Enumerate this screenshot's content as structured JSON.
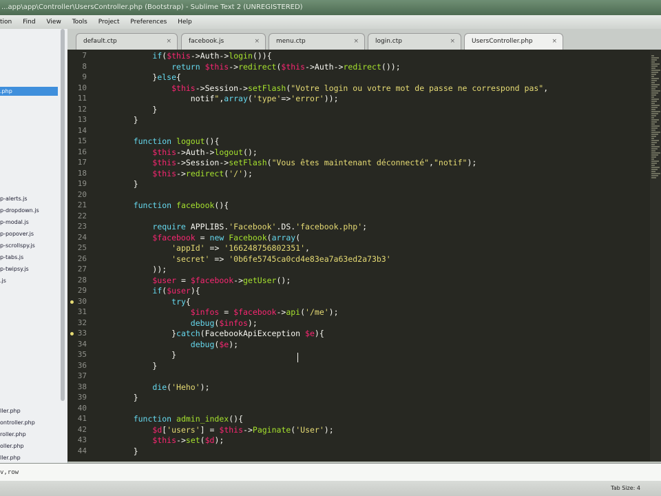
{
  "window": {
    "title": "...app\\app\\Controller\\UsersController.php (Bootstrap) - Sublime Text 2 (UNREGISTERED)"
  },
  "menu": [
    "tion",
    "Find",
    "View",
    "Tools",
    "Project",
    "Preferences",
    "Help"
  ],
  "sidebar": {
    "items": [
      {
        "label": ".php",
        "selected": true
      },
      {
        "label": "p-alerts.js"
      },
      {
        "label": "p-dropdown.js"
      },
      {
        "label": "p-modal.js"
      },
      {
        "label": "p-popover.js"
      },
      {
        "label": "p-scrollspy.js"
      },
      {
        "label": "p-tabs.js"
      },
      {
        "label": "p-twipsy.js"
      },
      {
        "label": ".js"
      },
      {
        "label": "ller.php"
      },
      {
        "label": "ontroller.php"
      },
      {
        "label": "roller.php"
      },
      {
        "label": "oller.php"
      },
      {
        "label": "ller.php"
      }
    ]
  },
  "tabs": [
    {
      "label": "default.ctp",
      "active": false
    },
    {
      "label": "facebook.js",
      "active": false
    },
    {
      "label": "menu.ctp",
      "active": false
    },
    {
      "label": "login.ctp",
      "active": false
    },
    {
      "label": "UsersController.php",
      "active": true
    }
  ],
  "tab_close": "×",
  "editor": {
    "line_numbers": [
      "7",
      "8",
      "9",
      "10",
      "11",
      "12",
      "13",
      "14",
      "15",
      "16",
      "17",
      "18",
      "19",
      "20",
      "21",
      "22",
      "23",
      "24",
      "25",
      "26",
      "27",
      "28",
      "29",
      "30",
      "31",
      "32",
      "33",
      "34",
      "35",
      "36",
      "37",
      "38",
      "39",
      "40",
      "41",
      "42",
      "43",
      "44"
    ],
    "modified_lines": [
      "30",
      "33"
    ],
    "code": [
      "        if($this->Auth->login()){",
      "            return $this->redirect($this->Auth->redirect());",
      "        }else{",
      "            $this->Session->setFlash(\"Votre login ou votre mot de passe ne correspond pas\",",
      "                notif\",array('type'=>'error'));",
      "        }",
      "    }",
      "",
      "    function logout(){",
      "        $this->Auth->logout();",
      "        $this->Session->setFlash(\"Vous êtes maintenant déconnecté\",\"notif\");",
      "        $this->redirect('/');",
      "    }",
      "",
      "    function facebook(){",
      "",
      "        require APPLIBS.'Facebook'.DS.'facebook.php';",
      "        $facebook = new Facebook(array(",
      "            'appId' => '166248756802351',",
      "            'secret' => '0b6fe5745ca0cd4e83ea7a63ed2a73b3'",
      "        ));",
      "        $user = $facebook->getUser();",
      "        if($user){",
      "            try{",
      "                $infos = $facebook->api('/me');",
      "                debug($infos);",
      "            }catch(FacebookApiException $e){",
      "                debug($e);",
      "            }",
      "        }",
      "",
      "        die('Heho');",
      "    }",
      "",
      "    function admin_index(){",
      "        $d['users'] = $this->Paginate('User');",
      "        $this->set($d);",
      "    }"
    ]
  },
  "console": {
    "text": "v,row"
  },
  "status": {
    "tab_size": "Tab Size: 4"
  }
}
